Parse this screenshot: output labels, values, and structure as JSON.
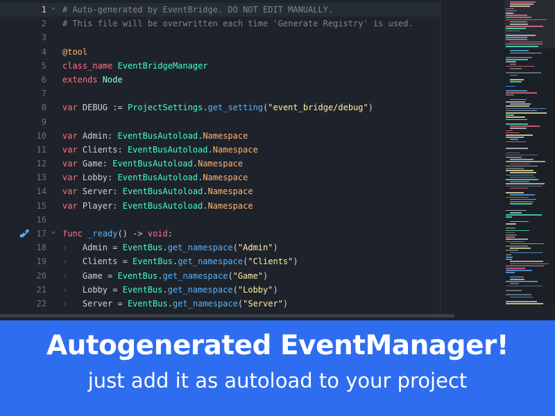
{
  "colors": {
    "editor_bg": "#1e232b",
    "banner_bg": "#2f6df0",
    "comment": "#7d8590",
    "keyword": "#ff7085",
    "annotation": "#ffb373",
    "builtin_type": "#8effda",
    "class": "#42ffc2",
    "function": "#57b3ff",
    "string": "#ffeda1",
    "text": "#cdd3db"
  },
  "editor": {
    "current_line": 1,
    "lines": [
      {
        "n": "1",
        "fold": true,
        "tokens": [
          [
            "cm",
            "# Auto-generated by EventBridge. DO NOT EDIT MANUALLY."
          ]
        ]
      },
      {
        "n": "2",
        "tokens": [
          [
            "cm",
            "# This file will be overwritten each time 'Generate Registry' is used."
          ]
        ]
      },
      {
        "n": "3",
        "tokens": []
      },
      {
        "n": "4",
        "tokens": [
          [
            "an",
            "@tool"
          ]
        ]
      },
      {
        "n": "5",
        "tokens": [
          [
            "kw",
            "class_name"
          ],
          [
            "tx",
            " "
          ],
          [
            "cl",
            "EventBridgeManager"
          ]
        ]
      },
      {
        "n": "6",
        "tokens": [
          [
            "kw",
            "extends"
          ],
          [
            "tx",
            " "
          ],
          [
            "ty",
            "Node"
          ]
        ]
      },
      {
        "n": "7",
        "tokens": []
      },
      {
        "n": "8",
        "tokens": [
          [
            "kw",
            "var"
          ],
          [
            "tx",
            " DEBUG := "
          ],
          [
            "cl",
            "ProjectSettings"
          ],
          [
            "tx",
            "."
          ],
          [
            "fn",
            "get_setting"
          ],
          [
            "tx",
            "("
          ],
          [
            "st",
            "\"event_bridge/debug\""
          ],
          [
            "tx",
            ")"
          ]
        ]
      },
      {
        "n": "9",
        "tokens": []
      },
      {
        "n": "10",
        "tokens": [
          [
            "kw",
            "var"
          ],
          [
            "tx",
            " Admin: "
          ],
          [
            "cl",
            "EventBusAutoload"
          ],
          [
            "tx",
            "."
          ],
          [
            "an",
            "Namespace"
          ]
        ]
      },
      {
        "n": "11",
        "tokens": [
          [
            "kw",
            "var"
          ],
          [
            "tx",
            " Clients: "
          ],
          [
            "cl",
            "EventBusAutoload"
          ],
          [
            "tx",
            "."
          ],
          [
            "an",
            "Namespace"
          ]
        ]
      },
      {
        "n": "12",
        "tokens": [
          [
            "kw",
            "var"
          ],
          [
            "tx",
            " Game: "
          ],
          [
            "cl",
            "EventBusAutoload"
          ],
          [
            "tx",
            "."
          ],
          [
            "an",
            "Namespace"
          ]
        ]
      },
      {
        "n": "13",
        "tokens": [
          [
            "kw",
            "var"
          ],
          [
            "tx",
            " Lobby: "
          ],
          [
            "cl",
            "EventBusAutoload"
          ],
          [
            "tx",
            "."
          ],
          [
            "an",
            "Namespace"
          ]
        ]
      },
      {
        "n": "14",
        "tokens": [
          [
            "kw",
            "var"
          ],
          [
            "tx",
            " Server: "
          ],
          [
            "cl",
            "EventBusAutoload"
          ],
          [
            "tx",
            "."
          ],
          [
            "an",
            "Namespace"
          ]
        ]
      },
      {
        "n": "15",
        "tokens": [
          [
            "kw",
            "var"
          ],
          [
            "tx",
            " Player: "
          ],
          [
            "cl",
            "EventBusAutoload"
          ],
          [
            "tx",
            "."
          ],
          [
            "an",
            "Namespace"
          ]
        ]
      },
      {
        "n": "16",
        "tokens": []
      },
      {
        "n": "17",
        "fold": true,
        "override_icon": true,
        "tokens": [
          [
            "kw",
            "func"
          ],
          [
            "tx",
            " "
          ],
          [
            "fn",
            "_ready"
          ],
          [
            "tx",
            "() -> "
          ],
          [
            "kw",
            "void"
          ],
          [
            "tx",
            ":"
          ]
        ]
      },
      {
        "n": "18",
        "tab": true,
        "tokens": [
          [
            "tx",
            "Admin = "
          ],
          [
            "cl",
            "EventBus"
          ],
          [
            "tx",
            "."
          ],
          [
            "fn",
            "get_namespace"
          ],
          [
            "tx",
            "("
          ],
          [
            "st",
            "\"Admin\""
          ],
          [
            "tx",
            ")"
          ]
        ]
      },
      {
        "n": "19",
        "tab": true,
        "tokens": [
          [
            "tx",
            "Clients = "
          ],
          [
            "cl",
            "EventBus"
          ],
          [
            "tx",
            "."
          ],
          [
            "fn",
            "get_namespace"
          ],
          [
            "tx",
            "("
          ],
          [
            "st",
            "\"Clients\""
          ],
          [
            "tx",
            ")"
          ]
        ]
      },
      {
        "n": "20",
        "tab": true,
        "tokens": [
          [
            "tx",
            "Game = "
          ],
          [
            "cl",
            "EventBus"
          ],
          [
            "tx",
            "."
          ],
          [
            "fn",
            "get_namespace"
          ],
          [
            "tx",
            "("
          ],
          [
            "st",
            "\"Game\""
          ],
          [
            "tx",
            ")"
          ]
        ]
      },
      {
        "n": "21",
        "tab": true,
        "tokens": [
          [
            "tx",
            "Lobby = "
          ],
          [
            "cl",
            "EventBus"
          ],
          [
            "tx",
            "."
          ],
          [
            "fn",
            "get_namespace"
          ],
          [
            "tx",
            "("
          ],
          [
            "st",
            "\"Lobby\""
          ],
          [
            "tx",
            ")"
          ]
        ]
      },
      {
        "n": "22",
        "tab": true,
        "tokens": [
          [
            "tx",
            "Server = "
          ],
          [
            "cl",
            "EventBus"
          ],
          [
            "tx",
            "."
          ],
          [
            "fn",
            "get_namespace"
          ],
          [
            "tx",
            "("
          ],
          [
            "st",
            "\"Server\""
          ],
          [
            "tx",
            ")"
          ]
        ]
      }
    ]
  },
  "icons": {
    "fold": "chevron-down-icon",
    "tab": "tab-indent-icon",
    "override": "method-override-icon"
  },
  "banner": {
    "headline": "Autogenerated EventManager!",
    "subline": "just add it as autoload to your project"
  }
}
